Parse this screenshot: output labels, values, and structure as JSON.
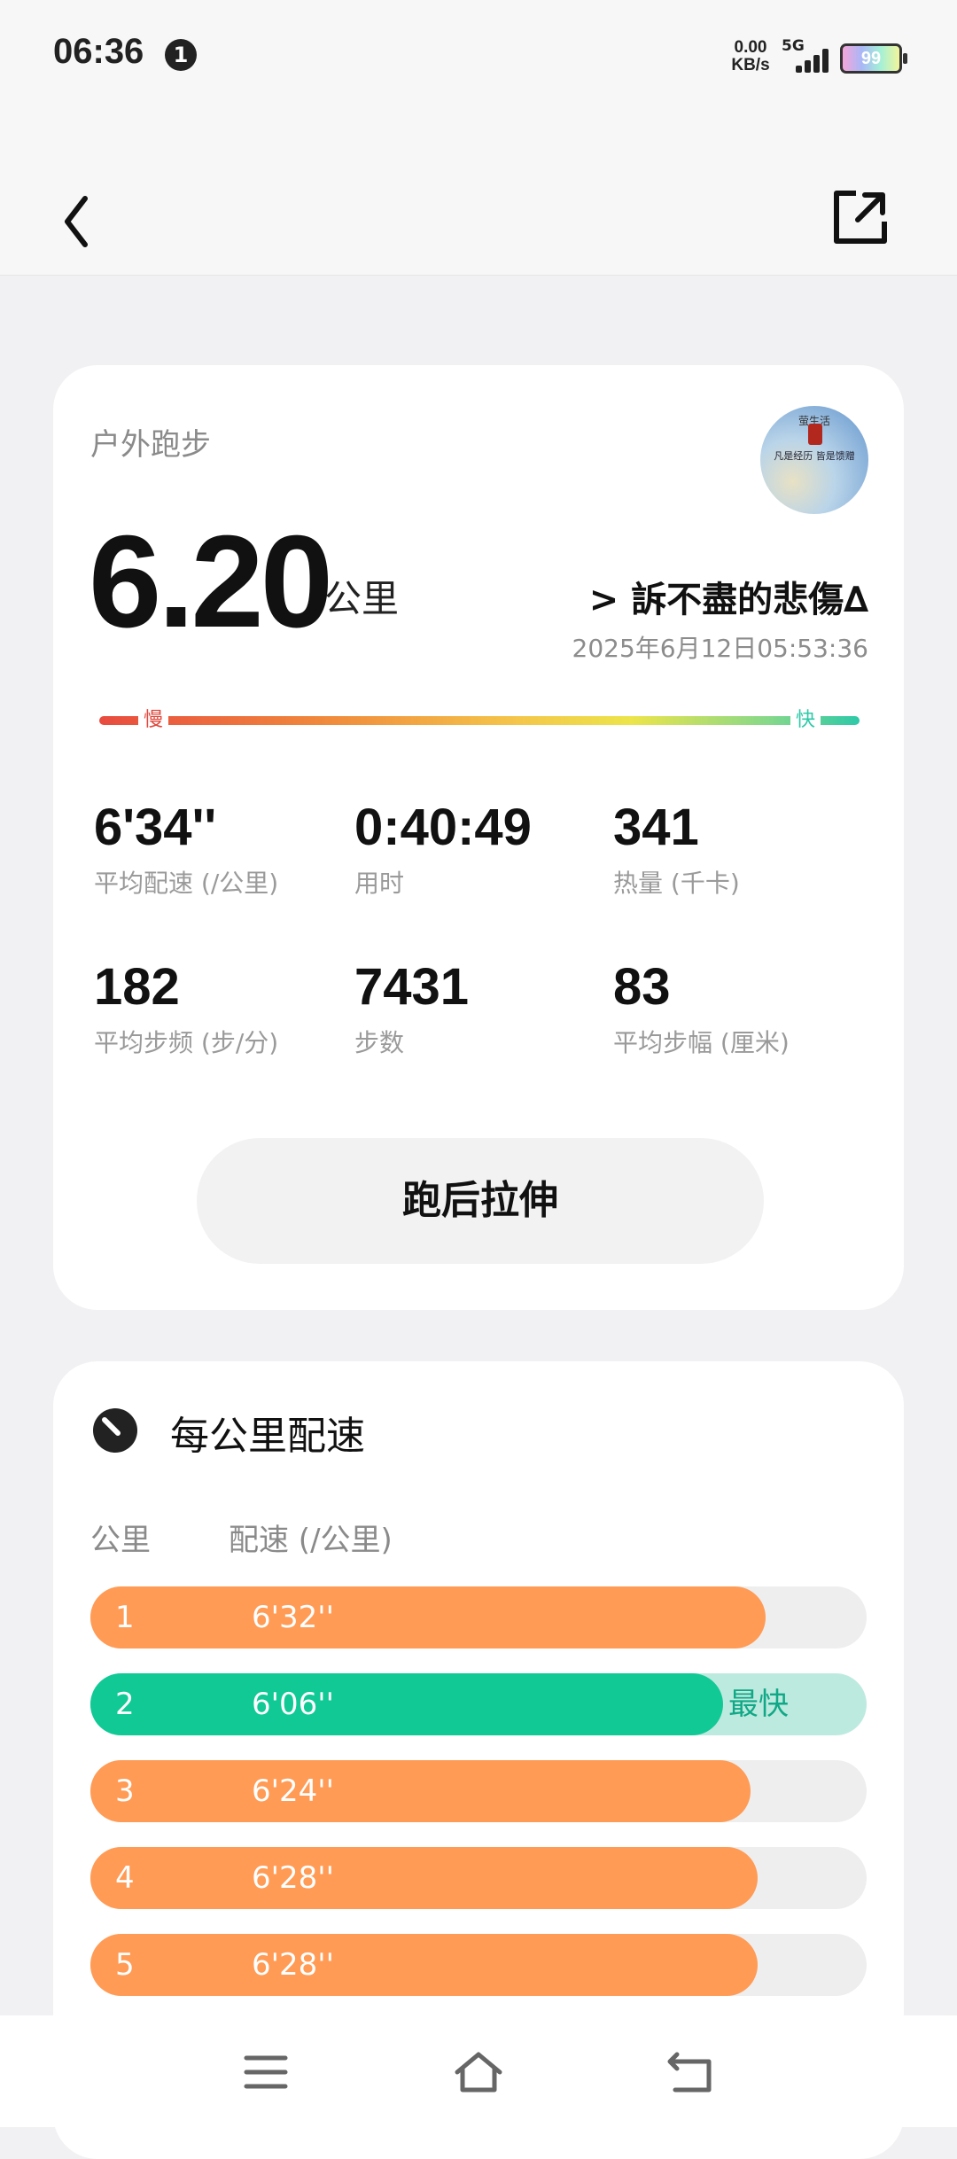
{
  "status_bar": {
    "time": "06:36",
    "notification_count": "1",
    "net_speed_value": "0.00",
    "net_speed_unit": "KB/s",
    "signal_label": "5G",
    "battery_level": "99"
  },
  "header": {
    "back_icon": "chevron-left-icon",
    "share_icon": "external-share-icon"
  },
  "summary": {
    "activity_type": "户外跑步",
    "distance": "6.20",
    "distance_unit": "公里",
    "user_name": "> 訴不盡的悲傷∆",
    "datetime": "2025年6月12日05:53:36",
    "avatar_caption_top": "萤生活",
    "avatar_caption_bottom": "凡是经历 皆是馈赠",
    "pace_scale": {
      "slow_label": "慢",
      "fast_label": "快"
    },
    "stats": [
      {
        "value": "6'34''",
        "label": "平均配速 (/公里)"
      },
      {
        "value": "0:40:49",
        "label": "用时"
      },
      {
        "value": "341",
        "label": "热量 (千卡)"
      },
      {
        "value": "182",
        "label": "平均步频 (步/分)"
      },
      {
        "value": "7431",
        "label": "步数"
      },
      {
        "value": "83",
        "label": "平均步幅 (厘米)"
      }
    ],
    "stretch_button": "跑后拉伸"
  },
  "splits": {
    "title": "每公里配速",
    "icon": "speedometer-icon",
    "col_km": "公里",
    "col_pace": "配速 (/公里)",
    "fastest_label": "最快",
    "rows": [
      {
        "km": "1",
        "pace": "6'32''",
        "fill": 0.87,
        "fastest": false
      },
      {
        "km": "2",
        "pace": "6'06''",
        "fill": 0.815,
        "fastest": true
      },
      {
        "km": "3",
        "pace": "6'24''",
        "fill": 0.85,
        "fastest": false
      },
      {
        "km": "4",
        "pace": "6'28''",
        "fill": 0.86,
        "fastest": false
      },
      {
        "km": "5",
        "pace": "6'28''",
        "fill": 0.86,
        "fastest": false
      }
    ]
  },
  "colors": {
    "slow_bar": "#ff9b55",
    "fast_bar": "#10c995",
    "fast_track": "#bdeadf"
  },
  "nav_bar": {
    "menu_icon": "menu-icon",
    "home_icon": "home-icon",
    "back_icon": "return-icon"
  }
}
